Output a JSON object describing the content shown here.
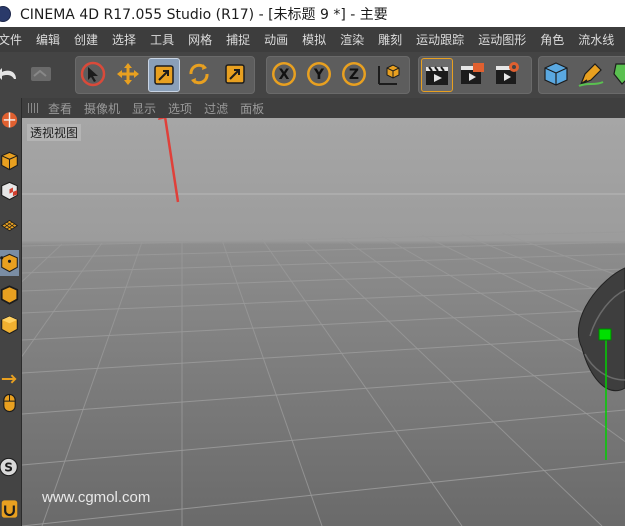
{
  "window": {
    "title": "CINEMA 4D R17.055 Studio (R17) - [未标题 9 *] - 主要"
  },
  "menubar": {
    "items": [
      "文件",
      "编辑",
      "创建",
      "选择",
      "工具",
      "网格",
      "捕捉",
      "动画",
      "模拟",
      "渲染",
      "雕刻",
      "运动跟踪",
      "运动图形",
      "角色",
      "流水线"
    ]
  },
  "toolbar": {
    "axis_x": "X",
    "axis_y": "Y",
    "axis_z": "Z"
  },
  "viewport_menu": {
    "items": [
      "查看",
      "摄像机",
      "显示",
      "选项",
      "过滤",
      "面板"
    ]
  },
  "viewport": {
    "label": "透视视图",
    "watermark": "www.cgmol.com"
  },
  "colors": {
    "accent_orange": "#e8a020",
    "annotation_red": "#e0403a",
    "axis_green": "#00d000"
  }
}
